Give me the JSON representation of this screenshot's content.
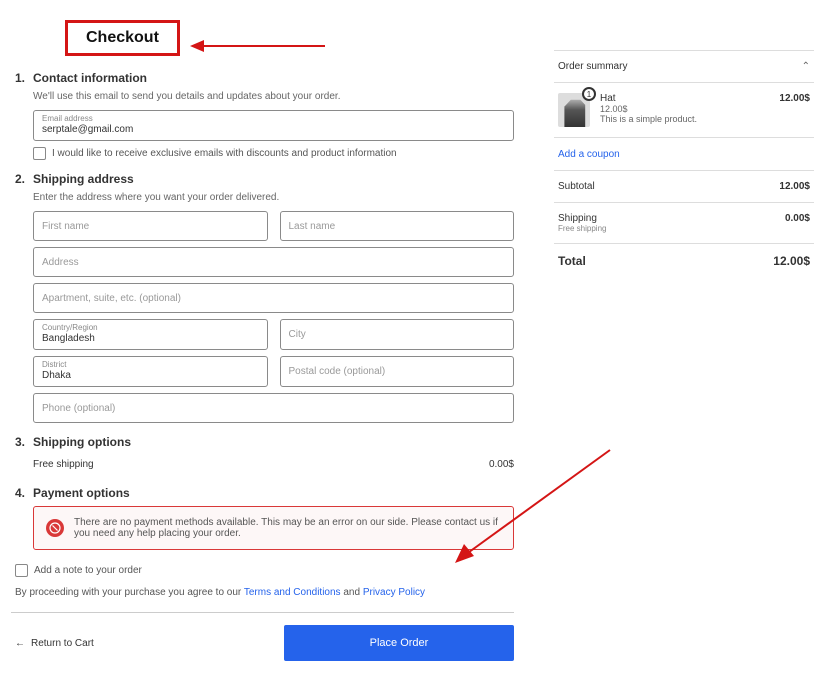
{
  "page_title": "Checkout",
  "contact": {
    "num": "1.",
    "title": "Contact information",
    "desc": "We'll use this email to send you details and updates about your order.",
    "email_label": "Email address",
    "email_value": "serptale@gmail.com",
    "marketing_label": "I would like to receive exclusive emails with discounts and product information"
  },
  "shipping": {
    "num": "2.",
    "title": "Shipping address",
    "desc": "Enter the address where you want your order delivered.",
    "first_name_ph": "First name",
    "last_name_ph": "Last name",
    "address_ph": "Address",
    "apt_ph": "Apartment, suite, etc. (optional)",
    "country_label": "Country/Region",
    "country_value": "Bangladesh",
    "city_ph": "City",
    "district_label": "District",
    "district_value": "Dhaka",
    "postal_ph": "Postal code (optional)",
    "phone_ph": "Phone (optional)"
  },
  "ship_options": {
    "num": "3.",
    "title": "Shipping options",
    "opt_label": "Free shipping",
    "opt_price": "0.00$"
  },
  "payment": {
    "num": "4.",
    "title": "Payment options",
    "error_msg": "There are no payment methods available. This may be an error on our side. Please contact us if you need any help placing your order."
  },
  "note_label": "Add a note to your order",
  "terms_prefix": "By proceeding with your purchase you agree to our ",
  "terms_link": "Terms and Conditions",
  "terms_and": " and ",
  "privacy_link": "Privacy Policy",
  "return_label": "Return to Cart",
  "place_order_label": "Place Order",
  "summary": {
    "title": "Order summary",
    "item": {
      "name": "Hat",
      "price_sub": "12.00$",
      "desc": "This is a simple product.",
      "price": "12.00$",
      "qty": "1"
    },
    "coupon_label": "Add a coupon",
    "subtotal_label": "Subtotal",
    "subtotal_value": "12.00$",
    "shipping_label": "Shipping",
    "shipping_sub": "Free shipping",
    "shipping_value": "0.00$",
    "total_label": "Total",
    "total_value": "12.00$"
  }
}
